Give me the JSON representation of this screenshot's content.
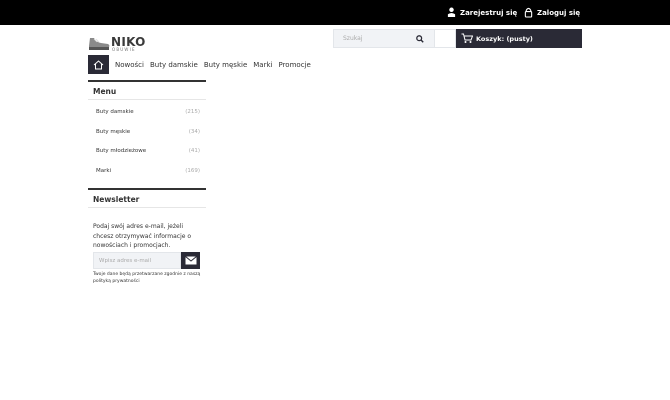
{
  "topbar": {
    "register_label": "Zarejestruj się",
    "login_label": "Zaloguj się"
  },
  "logo": {
    "brand": "NIKO",
    "subtitle": "OBUWIE"
  },
  "search": {
    "placeholder": "Szukaj"
  },
  "cart": {
    "label": "Koszyk: (pusty)"
  },
  "nav": {
    "items": [
      "Nowości",
      "Buty damskie",
      "Buty męskie",
      "Marki",
      "Promocje"
    ]
  },
  "menu": {
    "title": "Menu",
    "items": [
      {
        "label": "Buty damskie",
        "count": "(215)"
      },
      {
        "label": "Buty męskie",
        "count": "(34)"
      },
      {
        "label": "Buty młodzieżowe",
        "count": "(41)"
      },
      {
        "label": "Marki",
        "count": "(169)"
      }
    ]
  },
  "newsletter": {
    "title": "Newsletter",
    "text": "Podaj swój adres e-mail, jeżeli chcesz otrzymywać informacje o nowościach i promocjach.",
    "input_placeholder": "Wpisz adres e-mail",
    "note": "Twoje dane będą przetwarzane zgodnie z naszą polityką prywatności"
  },
  "colors": {
    "topbar": "#000000",
    "dark_accent": "#2a2a36",
    "input_bg": "#f1f3f6"
  }
}
